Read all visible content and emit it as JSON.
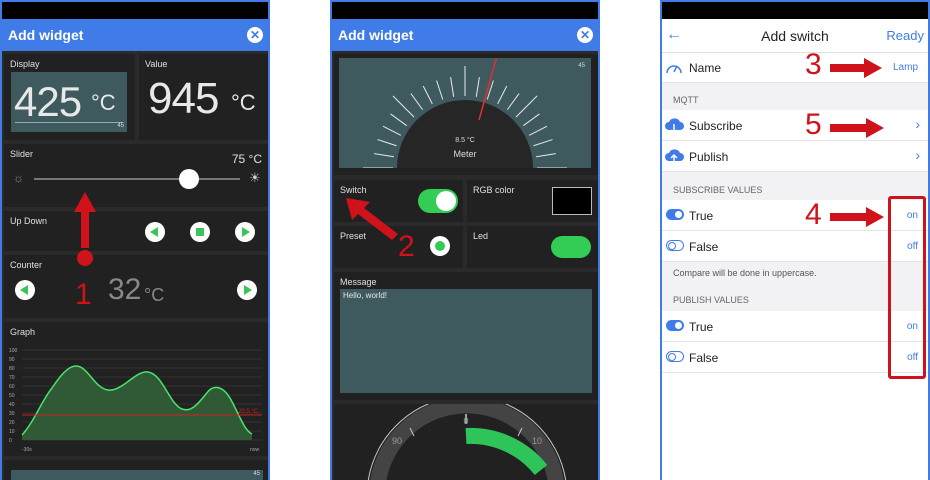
{
  "screen1": {
    "title": "Add widget",
    "display": {
      "label": "Display",
      "value": "425",
      "unit": "°C",
      "corner": "45"
    },
    "value_tile": {
      "label": "Value",
      "value": "945",
      "unit": "°C"
    },
    "slider": {
      "label": "Slider",
      "value": "75 °C",
      "level": 0.75
    },
    "updown": {
      "label": "Up Down"
    },
    "counter": {
      "label": "Counter",
      "value": "32",
      "unit": "°C"
    },
    "graph": {
      "label": "Graph",
      "yticks": [
        "100",
        "90",
        "80",
        "70",
        "60",
        "50",
        "40",
        "30",
        "20",
        "10",
        "0"
      ],
      "xstart": "-30s",
      "xend": "now",
      "corner": "20.5 °C"
    },
    "bottom_corner": "45",
    "annotation": "1"
  },
  "screen2": {
    "title": "Add widget",
    "meter": {
      "label": "Meter",
      "value": "8.5 °C",
      "corner": "45"
    },
    "switch": {
      "label": "Switch",
      "on": true
    },
    "rgb": {
      "label": "RGB color",
      "color": "#000000"
    },
    "preset": {
      "label": "Preset"
    },
    "led": {
      "label": "Led",
      "color": "#33cc55"
    },
    "message": {
      "label": "Message",
      "text": "Hello, world!"
    },
    "dial": {
      "top": "0",
      "left": "90",
      "right": "10"
    },
    "annotation": "2"
  },
  "screen3": {
    "title": "Add switch",
    "status": "Ready",
    "name_row": {
      "label": "Name",
      "value": "Lamp"
    },
    "mqtt_section": "MQTT",
    "subscribe": "Subscribe",
    "publish": "Publish",
    "sub_values_section": "SUBSCRIBE VALUES",
    "sub_true": {
      "label": "True",
      "value": "on"
    },
    "sub_false": {
      "label": "False",
      "value": "off"
    },
    "note": "Compare will be done in uppercase.",
    "pub_values_section": "PUBLISH VALUES",
    "pub_true": {
      "label": "True",
      "value": "on"
    },
    "pub_false": {
      "label": "False",
      "value": "off"
    },
    "annotations": [
      "3",
      "5",
      "4"
    ]
  },
  "colors": {
    "accent": "#3f7ce8",
    "tile": "#212121",
    "lcd": "#3f5a5e",
    "green": "#3cc45a",
    "annotation_red": "#d0121b"
  }
}
